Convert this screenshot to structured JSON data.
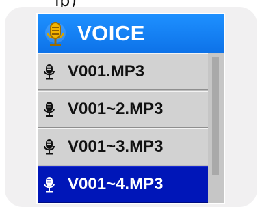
{
  "top_text": "lp)",
  "header": {
    "title": "VOICE",
    "icon": "microphone-icon"
  },
  "list": {
    "items": [
      {
        "label": "V001.MP3",
        "icon": "microphone-icon",
        "selected": false
      },
      {
        "label": "V001~2.MP3",
        "icon": "microphone-icon",
        "selected": false
      },
      {
        "label": "V001~3.MP3",
        "icon": "microphone-icon",
        "selected": false
      },
      {
        "label": "V001~4.MP3",
        "icon": "microphone-icon",
        "selected": true
      }
    ]
  },
  "colors": {
    "header": "#1e90ff",
    "selected_row": "#0016b8",
    "row": "#d2d2d2",
    "device_bezel": "#f1f0f1"
  }
}
